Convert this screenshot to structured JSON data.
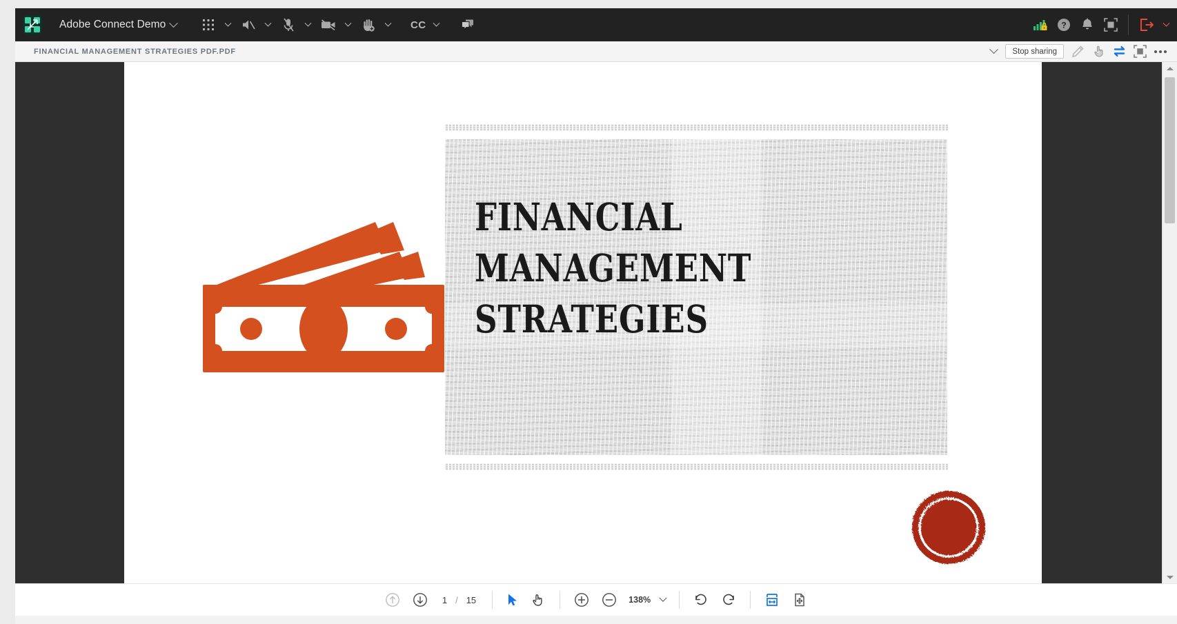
{
  "meeting_bar": {
    "logo_icon": "adobe-connect-logo",
    "title": "Adobe Connect Demo",
    "title_chevron": "chevron-down-icon",
    "controls": [
      {
        "icon": "apps-grid-icon",
        "label": "",
        "chevron": true
      },
      {
        "icon": "speaker-muted-icon",
        "label": "",
        "chevron": true
      },
      {
        "icon": "microphone-muted-icon",
        "label": "",
        "chevron": true
      },
      {
        "icon": "camera-off-icon",
        "label": "",
        "chevron": true
      },
      {
        "icon": "raise-hand-icon",
        "label": "",
        "chevron": true
      },
      {
        "icon": "closed-caption-icon",
        "label": "CC",
        "chevron": true
      },
      {
        "icon": "chat-bubbles-icon",
        "label": "",
        "chevron": false
      }
    ],
    "status_icons": [
      {
        "icon": "connection-strength-secure-icon",
        "color": "#28b36b"
      },
      {
        "icon": "help-icon",
        "color": "#9a9a9a"
      },
      {
        "icon": "notification-bell-icon",
        "color": "#9a9a9a"
      },
      {
        "icon": "fullscreen-icon",
        "color": "#9a9a9a"
      }
    ],
    "exit": {
      "icon": "exit-meeting-icon",
      "color": "#f0463c",
      "chevron": "chevron-down-icon"
    }
  },
  "doc_bar": {
    "file_name": "FINANCIAL MANAGEMENT STRATEGIES PDF.PDF",
    "collapse_chevron": "chevron-down-icon",
    "stop_sharing_label": "Stop sharing",
    "tools": [
      {
        "icon": "draw-pencil-icon",
        "state": "disabled"
      },
      {
        "icon": "pointer-hand-icon",
        "state": "normal"
      },
      {
        "icon": "sync-arrows-icon",
        "state": "active",
        "color": "#1473e6"
      },
      {
        "icon": "fullscreen-icon",
        "state": "normal"
      },
      {
        "icon": "more-options-icon",
        "state": "normal"
      }
    ]
  },
  "document": {
    "page_background": "#ffffff",
    "viewer_background": "#2f2f2f",
    "accent_orange": "#d4501e",
    "stamp_red": "#a82b12",
    "texture_gray": "#d2d2d2",
    "money_icon": "banknote-stack-icon",
    "stamp_icon": "grunge-circle-stamp-icon",
    "cover_title": "FINANCIAL\nMANAGEMENT\nSTRATEGIES"
  },
  "scrollbar": {
    "up_arrow_icon": "scroll-up-arrow-icon",
    "down_arrow_icon": "scroll-down-arrow-icon",
    "thumb_position_pct": 3,
    "thumb_size_pct": 29
  },
  "bottom_bar": {
    "prev_page_icon": "page-up-icon",
    "next_page_icon": "page-down-icon",
    "current_page": "1",
    "page_separator": "/",
    "total_pages": "15",
    "select_tool_icon": "select-arrow-icon",
    "pan_tool_icon": "pan-hand-icon",
    "zoom_in_icon": "zoom-in-icon",
    "zoom_out_icon": "zoom-out-icon",
    "zoom_level": "138%",
    "zoom_chevron": "chevron-down-icon",
    "rotate_ccw_icon": "rotate-counterclockwise-icon",
    "rotate_cw_icon": "rotate-clockwise-icon",
    "fit_width_icon": "fit-width-icon",
    "fit_page_icon": "fit-page-icon",
    "active_tool_color": "#1473e6"
  }
}
